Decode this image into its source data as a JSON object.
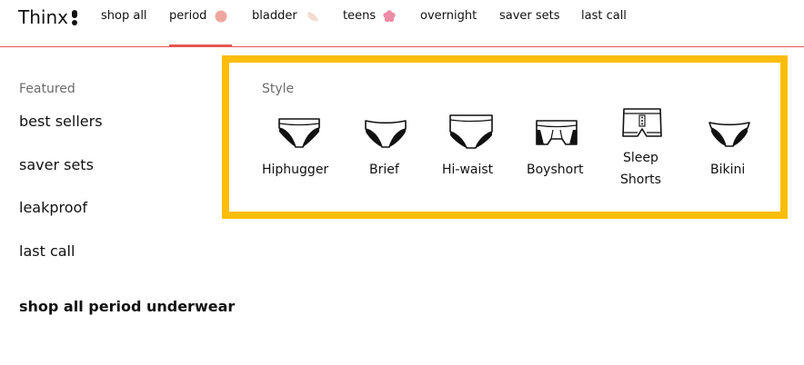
{
  "brand": {
    "name": "Thinx"
  },
  "nav": {
    "items": [
      {
        "label": "shop all"
      },
      {
        "label": "period",
        "dot_color": "#f0a6a0"
      },
      {
        "label": "bladder",
        "dot_color": "#f2dcd2"
      },
      {
        "label": "teens",
        "dot_color": "#f08aa6"
      },
      {
        "label": "overnight"
      },
      {
        "label": "saver sets"
      },
      {
        "label": "last call"
      }
    ],
    "active": "period",
    "accent_color": "#e8544e"
  },
  "sidebar": {
    "heading": "Featured",
    "items": [
      {
        "label": "best sellers"
      },
      {
        "label": "saver sets"
      },
      {
        "label": "leakproof"
      },
      {
        "label": "last call"
      }
    ],
    "shop_all": "shop all period underwear"
  },
  "style_panel": {
    "heading": "Style",
    "highlight_color": "#fbbd09",
    "styles": [
      {
        "label": "Hiphugger",
        "icon": "hiphugger-icon"
      },
      {
        "label": "Brief",
        "icon": "brief-icon"
      },
      {
        "label": "Hi-waist",
        "icon": "hi-waist-icon"
      },
      {
        "label": "Boyshort",
        "icon": "boyshort-icon"
      },
      {
        "label": "Sleep\nShorts",
        "icon": "sleep-shorts-icon"
      },
      {
        "label": "Bikini",
        "icon": "bikini-icon"
      }
    ]
  }
}
